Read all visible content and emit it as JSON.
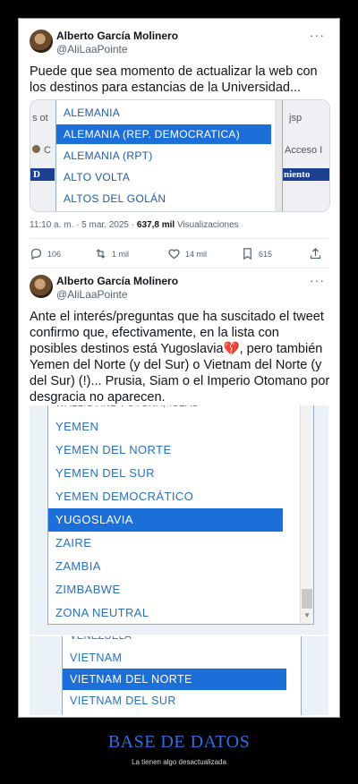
{
  "tweet1": {
    "author_name": "Alberto García Molinero",
    "author_handle": "@AliLaaPointe",
    "text": "Puede que sea momento de actualizar la web con los destinos para estancias de la Universidad...",
    "screenshot": {
      "left_fragments": [
        "s  ot",
        "C"
      ],
      "right_fragments": [
        "jsp",
        "Acceso I",
        "niento"
      ],
      "blue_left_text": "D",
      "options": [
        {
          "label": "ALEMANIA",
          "selected": false
        },
        {
          "label": "ALEMANIA (REP. DEMOCRATICA)",
          "selected": true
        },
        {
          "label": "ALEMANIA (RPT)",
          "selected": false
        },
        {
          "label": "ALTO VOLTA",
          "selected": false
        },
        {
          "label": "ALTOS DEL GOLÁN",
          "selected": false
        }
      ]
    },
    "timestamp": "11:10 a. m. · 5 mar. 2025 ·",
    "views_count": "637,8 mil",
    "views_label": "Visualizaciones",
    "actions": {
      "replies": "106",
      "retweets": "1 mil",
      "likes": "14 mil",
      "bookmarks": "615"
    }
  },
  "tweet2": {
    "author_name": "Alberto García Molinero",
    "author_handle": "@AliLaaPointe",
    "text": "Ante el interés/preguntas que ha suscitado el tweet confirmo que, efectivamente, en la lista con posibles destinos está Yugoslavia💔, pero también Yemen del Norte (y del Sur) o Vietnam del Norte (y del Sur) (!)... Prusia, Siam o el Imperio Otomano por desgracia no aparecen.",
    "screenshot_a": {
      "partial_top": "WALLIS AND FUTUNA, ISLAS",
      "options": [
        {
          "label": "YEMEN",
          "selected": false
        },
        {
          "label": "YEMEN DEL NORTE",
          "selected": false
        },
        {
          "label": "YEMEN DEL SUR",
          "selected": false
        },
        {
          "label": "YEMEN DEMOCRÁTICO",
          "selected": false
        },
        {
          "label": "YUGOSLAVIA",
          "selected": true
        },
        {
          "label": "ZAIRE",
          "selected": false
        },
        {
          "label": "ZAMBIA",
          "selected": false
        },
        {
          "label": "ZIMBABWE",
          "selected": false
        },
        {
          "label": "ZONA NEUTRAL",
          "selected": false
        }
      ]
    },
    "screenshot_b": {
      "partial_top": "VENEZUELA",
      "options": [
        {
          "label": "VIETNAM",
          "selected": false
        },
        {
          "label": "VIETNAM DEL NORTE",
          "selected": true
        },
        {
          "label": "VIETNAM DEL SUR",
          "selected": false
        }
      ]
    }
  },
  "caption": {
    "title": "BASE DE DATOS",
    "subtitle": "La tienen algo desactualizada"
  },
  "colors": {
    "accent_blue": "#1c6fd8",
    "caption_blue": "#2f6fe0",
    "text_dark": "#0f1419",
    "text_grey": "#536471"
  },
  "icons": {
    "reply": "reply-icon",
    "retweet": "retweet-icon",
    "like": "heart-icon",
    "bookmark": "bookmark-icon",
    "share": "share-icon",
    "more": "more-icon"
  }
}
